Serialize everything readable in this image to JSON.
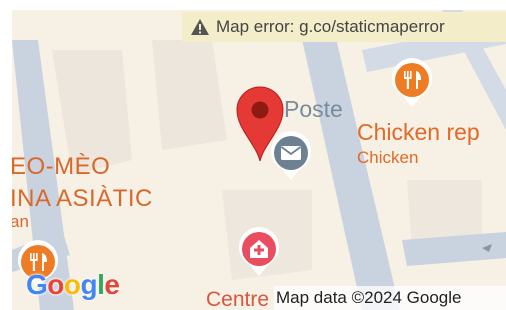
{
  "banner": {
    "text": "Map error: g.co/staticmaperror",
    "icon": "warning-icon"
  },
  "labels": {
    "poste": "Poste",
    "restaurant_name": "Chicken rep",
    "restaurant_category": "Chicken",
    "place_line1": "EO-MÈO",
    "place_line2": "INA ASIÀTIC",
    "place_line3": "an",
    "centre": "Centre"
  },
  "attribution": "Map data ©2024 Google",
  "logo": {
    "letters": [
      "G",
      "o",
      "o",
      "g",
      "l",
      "e"
    ],
    "colors": [
      "#4285F4",
      "#EA4335",
      "#FBBC05",
      "#4285F4",
      "#34A853",
      "#EA4335"
    ]
  },
  "colors": {
    "land": "#f6f0e5",
    "road": "#c9d2df",
    "marker": "#e53935",
    "restaurant_pin": "#ee7c25",
    "post_pin": "#6e8193",
    "hospital_pin": "#ea4d5f"
  },
  "icons": [
    "map-marker-icon",
    "mail-icon",
    "fork-knife-icon",
    "hospital-icon"
  ]
}
